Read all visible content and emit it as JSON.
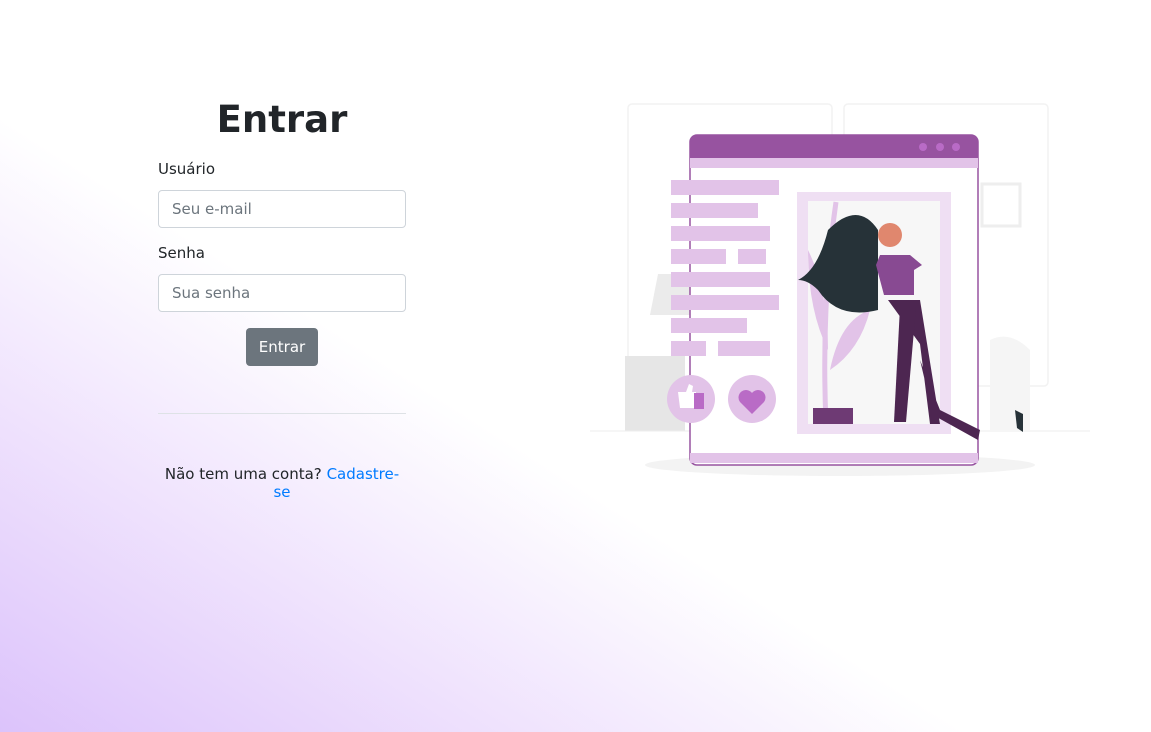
{
  "login": {
    "title": "Entrar",
    "username_label": "Usuário",
    "username_placeholder": "Seu e-mail",
    "username_value": "",
    "password_label": "Senha",
    "password_placeholder": "Sua senha",
    "password_value": "",
    "submit_label": "Entrar",
    "signup_prompt": "Não tem uma conta?",
    "signup_link": "Cadastre-se"
  },
  "colors": {
    "accent": "#9753a0",
    "light_accent": "#e2c3e8",
    "button": "#6c757d",
    "link": "#007bff",
    "background_gradient": "#dcc3fb"
  },
  "illustration": {
    "icons": [
      "thumbs-up-icon",
      "heart-icon"
    ]
  }
}
